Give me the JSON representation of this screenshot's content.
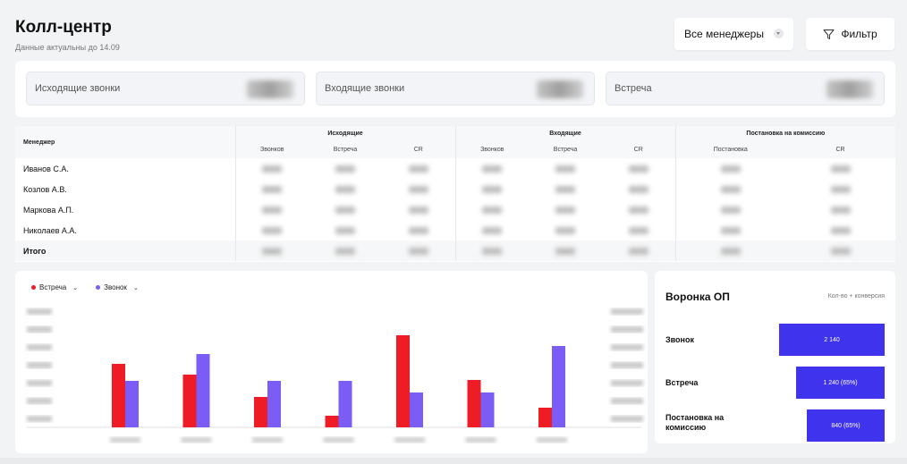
{
  "header": {
    "title": "Колл-центр",
    "subtitle": "Данные актуальны до 14.09"
  },
  "toolbar": {
    "manager_select": "Все менеджеры",
    "filter_label": "Фильтр"
  },
  "kpis": [
    {
      "label": "Исходящие звонки"
    },
    {
      "label": "Входящие звонки"
    },
    {
      "label": "Встреча"
    }
  ],
  "table": {
    "manager_header": "Менеджер",
    "groups": [
      {
        "label": "Исходящие",
        "sub": [
          "Звонков",
          "Встреча",
          "CR"
        ]
      },
      {
        "label": "Входящие",
        "sub": [
          "Звонков",
          "Встреча",
          "CR"
        ]
      },
      {
        "label": "Постановка на комиссию",
        "sub": [
          "Постановка",
          "CR"
        ]
      }
    ],
    "rows": [
      {
        "name": "Иванов С.А."
      },
      {
        "name": "Козлов А.В."
      },
      {
        "name": "Маркова А.П."
      },
      {
        "name": "Николаев А.А."
      }
    ],
    "total_label": "Итого"
  },
  "chart_data": {
    "type": "bar",
    "legend_placement": "top-left",
    "series": [
      {
        "name": "Встреча",
        "color": "#ee1c24",
        "values": [
          71,
          59,
          34,
          13,
          103,
          53,
          22
        ]
      },
      {
        "name": "Звонок",
        "color": "#7b5cf5",
        "values": [
          52,
          82,
          52,
          52,
          39,
          39,
          91
        ]
      }
    ],
    "grid": false
  },
  "funnel": {
    "title": "Воронка ОП",
    "meta": "Кол-во + конверсия",
    "color": "#3f33ee",
    "steps": [
      {
        "label": "Звонок",
        "value": "2 140",
        "share": 1.0
      },
      {
        "label": "Встреча",
        "value": "1 240 (65%)",
        "share": 0.84
      },
      {
        "label": "Постановка на комиссию",
        "value": "840 (65%)",
        "share": 0.74
      }
    ]
  }
}
